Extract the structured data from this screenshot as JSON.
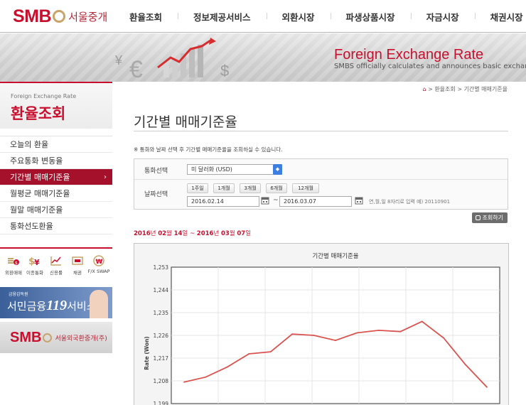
{
  "header": {
    "logo_text": "SMB",
    "logo_korean": "서울중개",
    "nav": [
      "환율조회",
      "정보제공서비스",
      "외환시장",
      "파생상품시장",
      "자금시장",
      "채권시장"
    ]
  },
  "banner": {
    "title": "Foreign Exchange Rate",
    "subtitle": "SMBS officially calculates and announces basic exchange r"
  },
  "sidebar": {
    "head_en": "Foreign Exchange Rate",
    "head_ko": "환율조회",
    "items": [
      {
        "label": "오늘의 환율"
      },
      {
        "label": "주요통화 변동율"
      },
      {
        "label": "기간별 매매기준율",
        "active": true
      },
      {
        "label": "월평균 매매기준율"
      },
      {
        "label": "월말 매매기준율"
      },
      {
        "label": "통화선도환율"
      }
    ],
    "active_arrow": "›",
    "quick_links": [
      {
        "label": "외환매매",
        "icon": "currency-exchange-icon"
      },
      {
        "label": "이종통화",
        "icon": "multi-currency-icon"
      },
      {
        "label": "신용률",
        "icon": "line-chart-icon"
      },
      {
        "label": "채권",
        "icon": "bond-icon"
      },
      {
        "label": "F/X SWAP",
        "icon": "won-swap-icon"
      }
    ],
    "banner_119": {
      "small": "금융감독원",
      "prefix": "서민금융",
      "number": "119",
      "suffix": "서비스"
    },
    "banner_smb": {
      "logo": "SMB",
      "text": "서울외국환중개(주)"
    }
  },
  "breadcrumb": {
    "home_icon": "⌂",
    "items": [
      "환율조회",
      "기간별 매매기준율"
    ],
    "separator": ">"
  },
  "page_title": "기간별 매매기준율",
  "notice": "※ 통화와 날짜 선택 후 기간별 매매기준율을 조회하실 수 있습니다.",
  "form": {
    "currency_label": "통화선택",
    "currency_value": "미 달러화 (USD)",
    "date_label": "날짜선택",
    "period_buttons": [
      "1주일",
      "1개월",
      "3개월",
      "6개월",
      "12개월"
    ],
    "start_date": "2016.02.14",
    "end_date": "2016.03.07",
    "tilde": "~",
    "hint": "연,월,일 8자리로 입력 예) 20110901",
    "search_label": "조회하기"
  },
  "period": {
    "y1": "2016",
    "u1": "년",
    "m1": "02",
    "u2": "월",
    "d1": "14",
    "u3": "일",
    "sep": " ~ ",
    "y2": "2016",
    "m2": "03",
    "d2": "07"
  },
  "colors": {
    "brand": "#c8102e",
    "line": "#d9534f",
    "accent_gold": "#c9a46a"
  },
  "chart_data": {
    "type": "line",
    "title": "기간별 매매기준율",
    "ylabel": "Rate (Won)",
    "xlabel": "",
    "ylim": [
      1199,
      1253
    ],
    "yticks": [
      "1,199",
      "1,208",
      "1,217",
      "1,226",
      "1,235",
      "1,244",
      "1,253"
    ],
    "grid": true,
    "series": [
      {
        "values": [
          1207.5,
          1209.5,
          1213.5,
          1218.7,
          1219.5,
          1226.5,
          1226.0,
          1224.0,
          1227.0,
          1228.0,
          1227.5,
          1231.5,
          1225.0,
          1214.5,
          1205.5
        ]
      }
    ]
  }
}
